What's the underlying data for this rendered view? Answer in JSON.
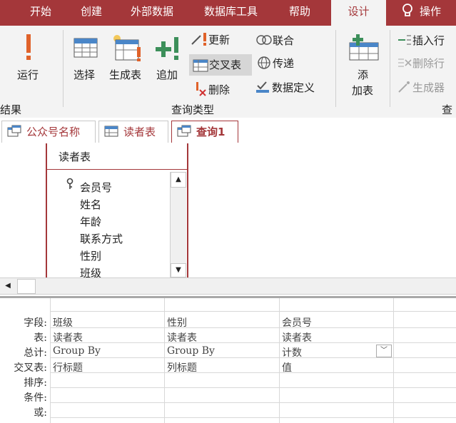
{
  "tabs": [
    "开始",
    "创建",
    "外部数据",
    "数据库工具",
    "帮助",
    "设计",
    "操作"
  ],
  "ribbon": {
    "run_label": "运行",
    "select_label": "选择",
    "make_table_label": "生成表",
    "append_label": "追加",
    "update_label": "更新",
    "crosstab_label": "交叉表",
    "delete_label": "删除",
    "union_label": "联合",
    "passthrough_label": "传递",
    "data_def_label": "数据定义",
    "add_table_label_1": "添",
    "add_table_label_2": "加表",
    "insert_row_label": "插入行",
    "delete_row_label": "删除行",
    "builder_label": "生成器",
    "results_group": "结果",
    "query_type_group": "查询类型",
    "query_setup_group": "查"
  },
  "doc_tabs": [
    "公众号名称",
    "读者表",
    "查询1"
  ],
  "table_box": {
    "title": "读者表",
    "fields": [
      "会员号",
      "姓名",
      "年龄",
      "联系方式",
      "性别",
      "班级"
    ]
  },
  "grid": {
    "row_labels": [
      "字段:",
      "表:",
      "总计:",
      "交叉表:",
      "排序:",
      "条件:",
      "或:"
    ],
    "columns": [
      {
        "field": "班级",
        "table": "读者表",
        "total": "Group By",
        "crosstab": "行标题"
      },
      {
        "field": "性别",
        "table": "读者表",
        "total": "Group By",
        "crosstab": "列标题"
      },
      {
        "field": "会员号",
        "table": "读者表",
        "total": "计数",
        "crosstab": "值"
      }
    ]
  },
  "colors": {
    "accent": "#a4373a"
  }
}
